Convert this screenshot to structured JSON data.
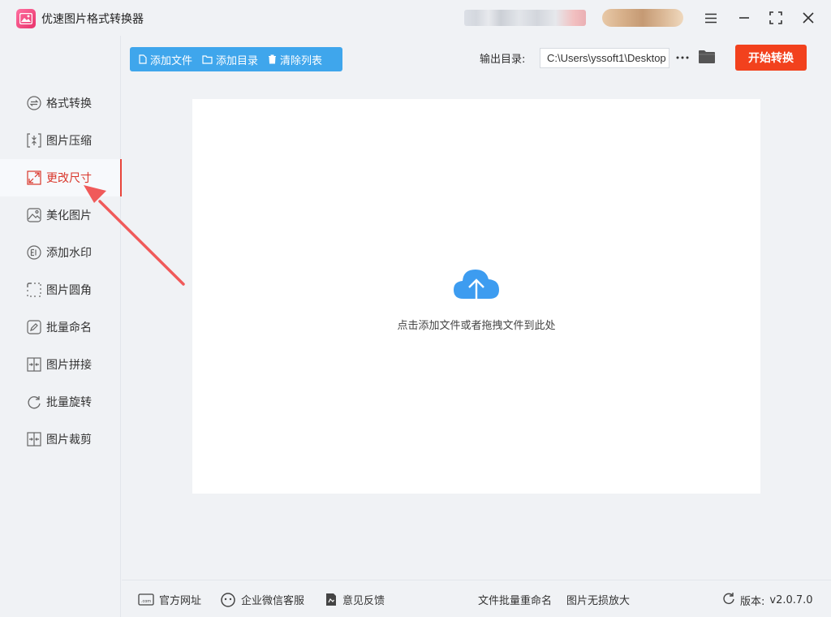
{
  "app": {
    "title": "优速图片格式转换器"
  },
  "sidebar": {
    "items": [
      {
        "label": "格式转换",
        "icon": "format-convert-icon"
      },
      {
        "label": "图片压缩",
        "icon": "compress-icon"
      },
      {
        "label": "更改尺寸",
        "icon": "resize-icon",
        "active": true
      },
      {
        "label": "美化图片",
        "icon": "beautify-icon"
      },
      {
        "label": "添加水印",
        "icon": "watermark-icon"
      },
      {
        "label": "图片圆角",
        "icon": "rounded-corner-icon"
      },
      {
        "label": "批量命名",
        "icon": "rename-icon"
      },
      {
        "label": "图片拼接",
        "icon": "stitch-icon"
      },
      {
        "label": "批量旋转",
        "icon": "rotate-icon"
      },
      {
        "label": "图片裁剪",
        "icon": "crop-icon"
      }
    ]
  },
  "toolbar": {
    "add_file": "添加文件",
    "add_dir": "添加目录",
    "clear_list": "清除列表",
    "output_label": "输出目录:",
    "output_path": "C:\\Users\\yssoft1\\Desktop",
    "start": "开始转换"
  },
  "drop": {
    "hint": "点击添加文件或者拖拽文件到此处"
  },
  "footer": {
    "website": "官方网址",
    "wechat": "企业微信客服",
    "feedback": "意见反馈",
    "batch_rename": "文件批量重命名",
    "lossless": "图片无损放大",
    "version_label": "版本:",
    "version": "v2.0.7.0"
  },
  "colors": {
    "accent": "#3fa6ec",
    "start": "#f2411d",
    "active": "#d9362b",
    "annotation": "#f05a5a"
  }
}
